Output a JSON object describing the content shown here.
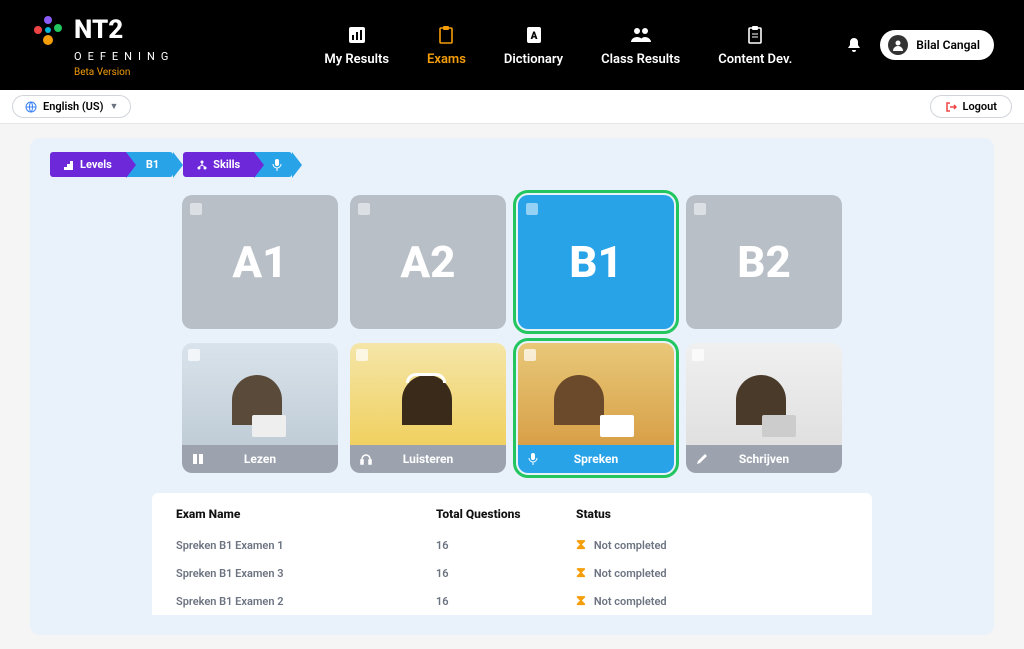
{
  "header": {
    "brand_name": "NT2",
    "brand_sub": "OEFENING",
    "beta": "Beta Version",
    "nav": [
      {
        "label": "My Results",
        "icon": "bar-chart-icon",
        "active": false
      },
      {
        "label": "Exams",
        "icon": "clipboard-icon",
        "active": true
      },
      {
        "label": "Dictionary",
        "icon": "book-a-icon",
        "active": false
      },
      {
        "label": "Class Results",
        "icon": "people-icon",
        "active": false
      },
      {
        "label": "Content Dev.",
        "icon": "clipboard-list-icon",
        "active": false
      }
    ],
    "user_name": "Bilal Cangal"
  },
  "subbar": {
    "language": "English (US)",
    "logout": "Logout"
  },
  "breadcrumbs": {
    "first": {
      "a": "Levels",
      "b": "B1"
    },
    "second": {
      "a": "Skills",
      "b_icon": "mic-icon"
    }
  },
  "levels": [
    {
      "code": "A1",
      "selected": false
    },
    {
      "code": "A2",
      "selected": false
    },
    {
      "code": "B1",
      "selected": true
    },
    {
      "code": "B2",
      "selected": false
    }
  ],
  "skills": [
    {
      "label": "Lezen",
      "icon": "book-icon",
      "selected": false,
      "img": "person-laptop-1"
    },
    {
      "label": "Luisteren",
      "icon": "headphones-icon",
      "selected": false,
      "img": "person-headphones"
    },
    {
      "label": "Spreken",
      "icon": "mic-icon",
      "selected": true,
      "img": "person-speaking"
    },
    {
      "label": "Schrijven",
      "icon": "pencil-icon",
      "selected": false,
      "img": "person-writing"
    }
  ],
  "table": {
    "headers": {
      "name": "Exam Name",
      "total": "Total Questions",
      "status": "Status"
    },
    "rows": [
      {
        "name": "Spreken B1 Examen 1",
        "total": "16",
        "status": "Not completed"
      },
      {
        "name": "Spreken B1 Examen 3",
        "total": "16",
        "status": "Not completed"
      },
      {
        "name": "Spreken B1 Examen 2",
        "total": "16",
        "status": "Not completed"
      }
    ]
  }
}
